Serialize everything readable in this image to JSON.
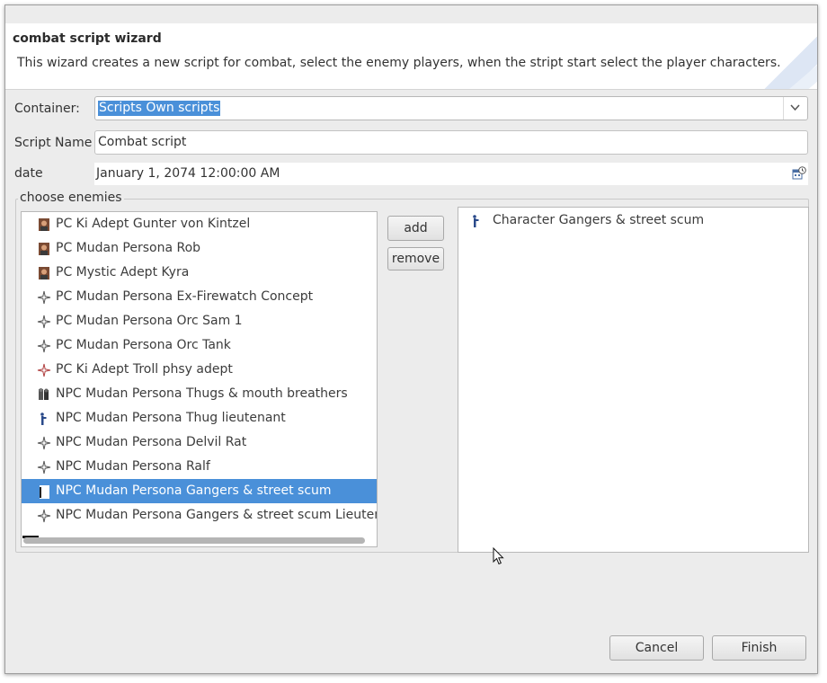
{
  "window": {
    "title": "combat script wizard",
    "description": "This wizard creates a new script for combat, select the enemy players, when the stript start select the player characters."
  },
  "form": {
    "container_label": "Container:",
    "container_value": "Scripts Own scripts",
    "script_name_label": "Script Name",
    "script_name_value": "Combat script",
    "date_label": "date",
    "date_value": "January 1, 2074 12:00:00 AM"
  },
  "enemies": {
    "group_label": "choose enemies",
    "available": [
      {
        "label": "PC Ki Adept Gunter von Kintzel",
        "icon": "portrait-icon"
      },
      {
        "label": "PC Mudan Persona Rob",
        "icon": "portrait-icon"
      },
      {
        "label": "PC Mystic Adept Kyra",
        "icon": "portrait-icon"
      },
      {
        "label": "PC Mudan Persona Ex-Firewatch Concept",
        "icon": "crosshair-icon"
      },
      {
        "label": "PC Mudan Persona Orc Sam 1",
        "icon": "crosshair-icon"
      },
      {
        "label": "PC Mudan Persona Orc Tank",
        "icon": "crosshair-icon"
      },
      {
        "label": "PC Ki Adept Troll phsy adept",
        "icon": "crosshair-red-icon"
      },
      {
        "label": "NPC Mudan Persona Thugs & mouth breathers",
        "icon": "thugs-icon"
      },
      {
        "label": "NPC Mudan Persona Thug lieutenant",
        "icon": "figure-icon"
      },
      {
        "label": "NPC Mudan Persona Delvil Rat",
        "icon": "crosshair-icon"
      },
      {
        "label": "NPC Mudan Persona Ralf",
        "icon": "crosshair-icon"
      },
      {
        "label": "NPC Mudan Persona Gangers & street scum",
        "icon": "figure-icon"
      },
      {
        "label": "NPC Mudan Persona Gangers & street scum Lieutenan",
        "icon": "crosshair-icon"
      }
    ],
    "selected_index": 11,
    "add_label": "add",
    "remove_label": "remove",
    "chosen": [
      {
        "label": "Character Gangers & street scum",
        "icon": "figure-icon"
      }
    ]
  },
  "footer": {
    "cancel_label": "Cancel",
    "finish_label": "Finish"
  },
  "colors": {
    "selection": "#4a90d9",
    "window_bg": "#ececec"
  }
}
